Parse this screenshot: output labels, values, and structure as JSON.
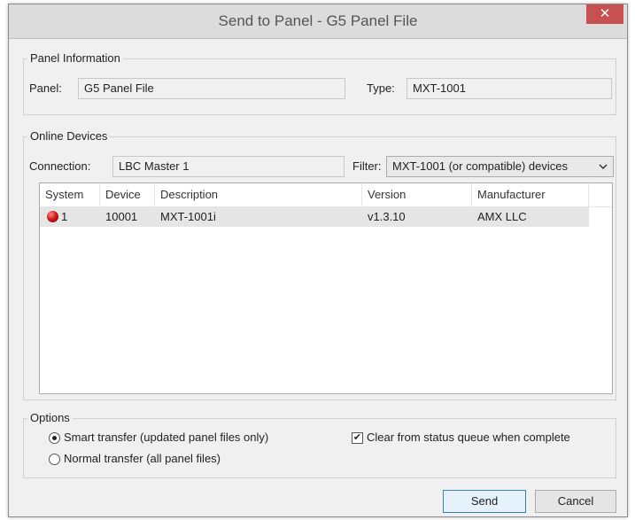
{
  "window": {
    "title": "Send to Panel - G5 Panel File",
    "close_glyph": "✕"
  },
  "panel_info": {
    "group_label": "Panel Information",
    "panel_label": "Panel:",
    "panel_value": "G5 Panel File",
    "type_label": "Type:",
    "type_value": "MXT-1001"
  },
  "online_devices": {
    "group_label": "Online Devices",
    "connection_label": "Connection:",
    "connection_value": "LBC Master 1",
    "filter_label": "Filter:",
    "filter_value": "MXT-1001 (or compatible) devices",
    "filter_icon": "chevron-down-icon",
    "columns": [
      "System",
      "Device",
      "Description",
      "Version",
      "Manufacturer"
    ],
    "rows": [
      {
        "status_color": "#d41a1a",
        "system": "1",
        "device": "10001",
        "description": "MXT-1001i",
        "version": "v1.3.10",
        "manufacturer": "AMX LLC"
      }
    ]
  },
  "options": {
    "group_label": "Options",
    "smart_transfer_label": "Smart transfer (updated panel files only)",
    "smart_transfer_selected": true,
    "normal_transfer_label": "Normal transfer (all panel files)",
    "normal_transfer_selected": false,
    "clear_queue_label": "Clear from status queue when complete",
    "clear_queue_checked": true,
    "check_glyph": "✔"
  },
  "buttons": {
    "send_label": "Send",
    "cancel_label": "Cancel"
  }
}
